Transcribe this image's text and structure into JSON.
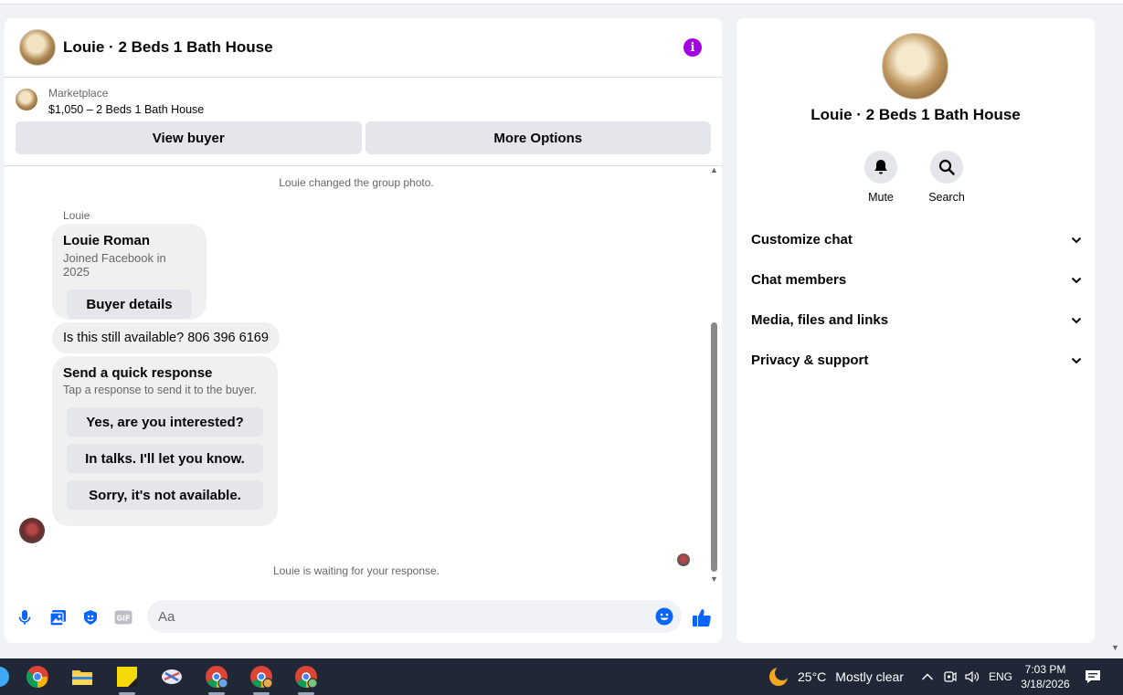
{
  "chat": {
    "title": "Louie · 2 Beds 1 Bath House",
    "info_icon": "i",
    "marketplace": {
      "label": "Marketplace",
      "listing": "$1,050 – 2 Beds 1 Bath House",
      "view_buyer": "View buyer",
      "more_options": "More Options"
    },
    "system_photo": "Louie changed the group photo.",
    "sender": "Louie",
    "profile_card": {
      "name": "Louie Roman",
      "joined": "Joined Facebook in 2025",
      "button": "Buyer details"
    },
    "message": "Is this still available? 806 396 6169",
    "quick": {
      "title": "Send a quick response",
      "subtitle": "Tap a response to send it to the buyer.",
      "options": [
        "Yes, are you interested?",
        "In talks. I'll let you know.",
        "Sorry, it's not available."
      ]
    },
    "waiting": "Louie is waiting for your response.",
    "composer_placeholder": "Aa"
  },
  "info": {
    "name": "Louie · 2 Beds 1 Bath House",
    "mute": "Mute",
    "search": "Search",
    "sections": [
      "Customize chat",
      "Chat members",
      "Media, files and links",
      "Privacy & support"
    ]
  },
  "taskbar": {
    "weather": "25°C",
    "weather_desc": "Mostly clear",
    "lang": "ENG",
    "time": "7:03 PM",
    "date": "3/18/2026"
  },
  "colors": {
    "accent": "#0866ff",
    "info": "#a200e0",
    "taskbar": "#202838"
  }
}
